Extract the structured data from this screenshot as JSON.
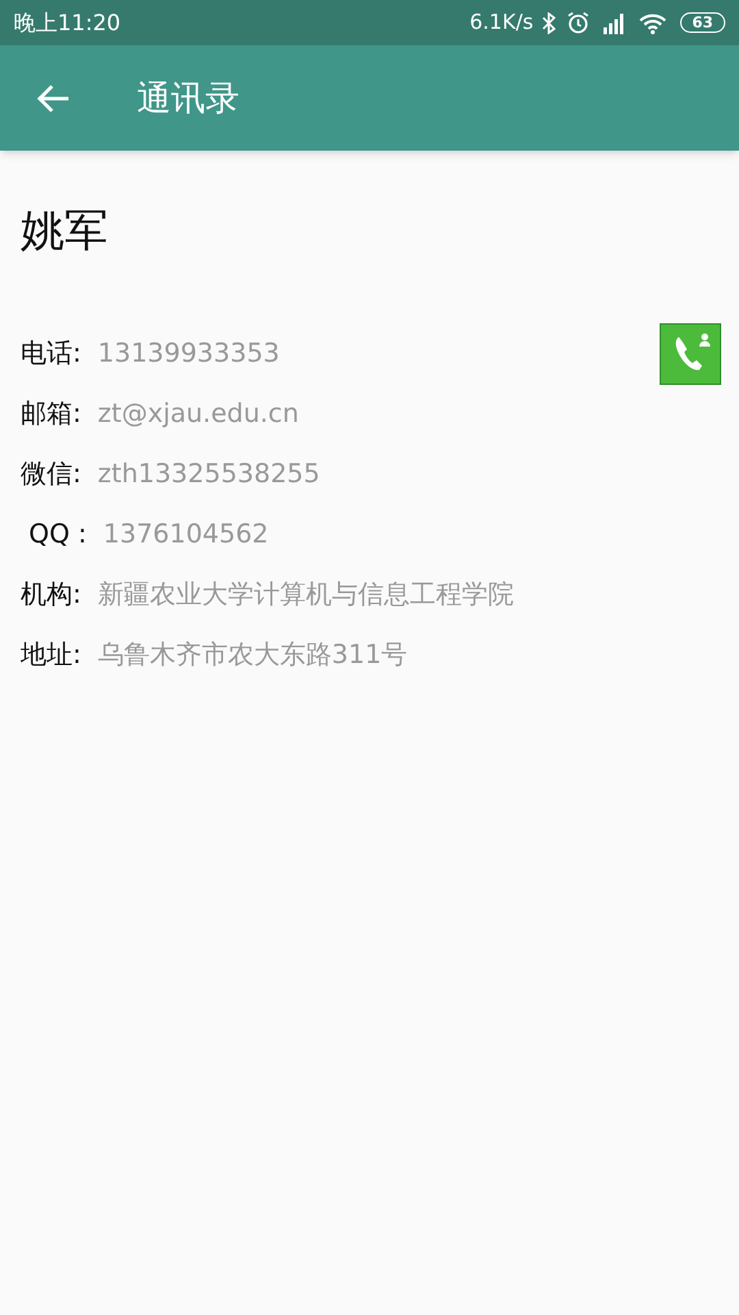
{
  "status_bar": {
    "time": "晚上11:20",
    "speed": "6.1K/s",
    "battery": "63"
  },
  "app_bar": {
    "title": "通讯录"
  },
  "contact": {
    "name": "姚军",
    "fields": [
      {
        "label": "电话:",
        "value": "13139933353",
        "kind": "phone"
      },
      {
        "label": "邮箱:",
        "value": "zt@xjau.edu.cn",
        "kind": "text"
      },
      {
        "label": "微信:",
        "value": "zth13325538255",
        "kind": "text"
      },
      {
        "label": " QQ :",
        "value": "1376104562",
        "kind": "text"
      },
      {
        "label": "机构:",
        "value": "新疆农业大学计算机与信息工程学院",
        "kind": "text"
      },
      {
        "label": "地址:",
        "value": "乌鲁木齐市农大东路311号",
        "kind": "text"
      }
    ]
  }
}
